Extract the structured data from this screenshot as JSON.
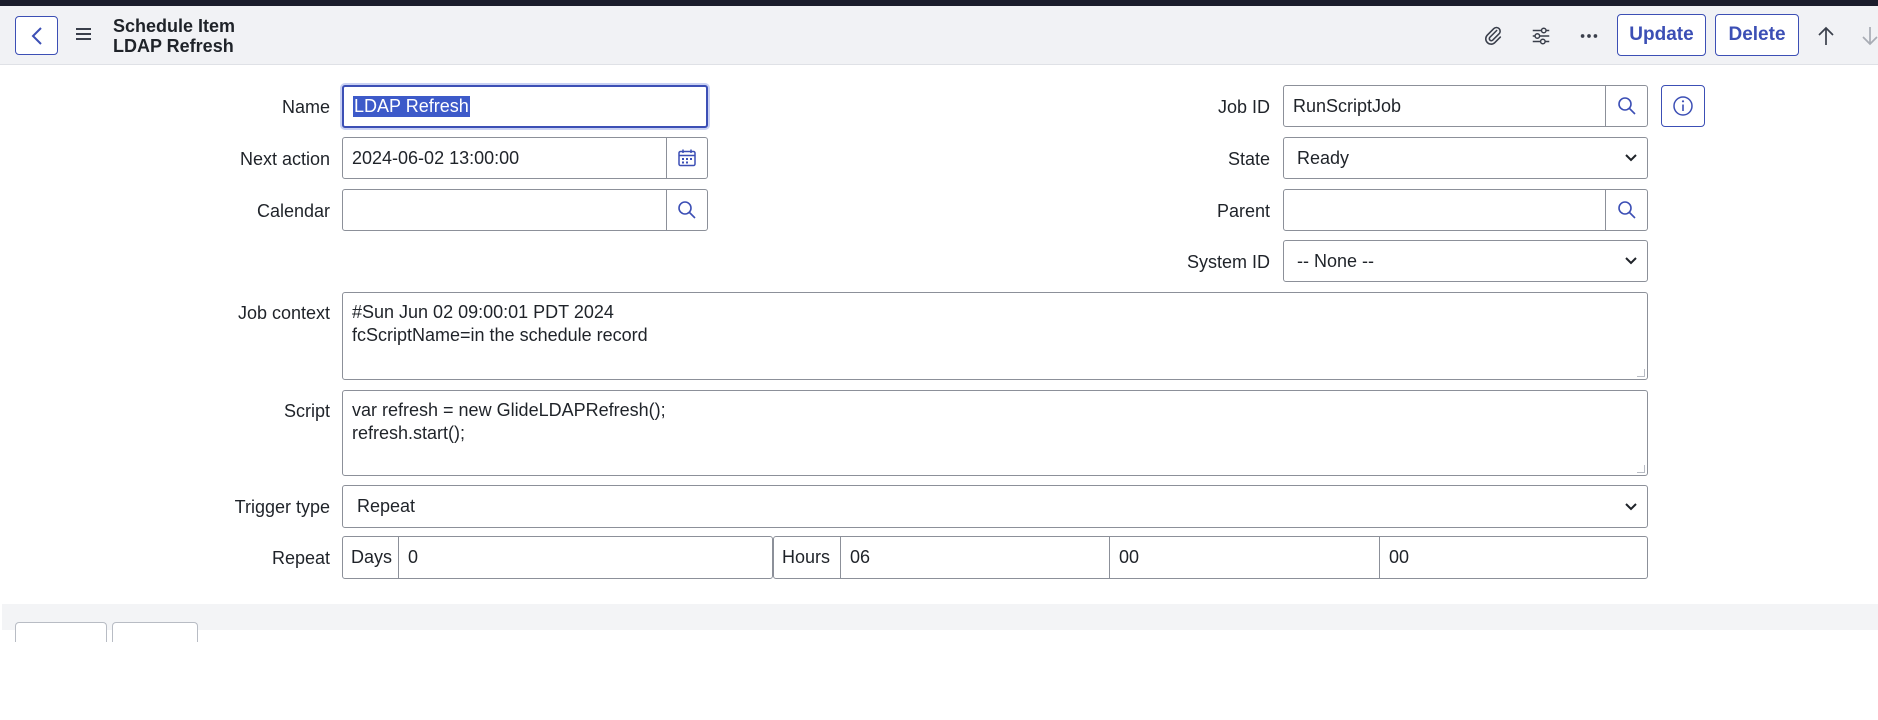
{
  "header": {
    "title_line1": "Schedule Item",
    "title_line2": "LDAP Refresh",
    "update_label": "Update",
    "delete_label": "Delete"
  },
  "form": {
    "name": {
      "label": "Name",
      "value": "LDAP Refresh"
    },
    "next_action": {
      "label": "Next action",
      "value": "2024-06-02 13:00:00"
    },
    "calendar": {
      "label": "Calendar",
      "value": ""
    },
    "job_id": {
      "label": "Job ID",
      "value": "RunScriptJob"
    },
    "state": {
      "label": "State",
      "value": "Ready"
    },
    "parent": {
      "label": "Parent",
      "value": ""
    },
    "system_id": {
      "label": "System ID",
      "value": "-- None --"
    },
    "job_context": {
      "label": "Job context",
      "lines": [
        "#Sun Jun 02 09:00:01 PDT 2024",
        "fcScriptName=in the schedule record"
      ]
    },
    "script": {
      "label": "Script",
      "lines": [
        "var refresh = new GlideLDAPRefresh();",
        "refresh.start();"
      ]
    },
    "trigger_type": {
      "label": "Trigger type",
      "value": "Repeat"
    },
    "repeat": {
      "label": "Repeat",
      "days_label": "Days",
      "days": "0",
      "hours_label": "Hours",
      "hours": "06",
      "minutes": "00",
      "seconds": "00"
    }
  },
  "colors": {
    "accent": "#3c4fb5",
    "header_bg": "#f1f2f5",
    "topbar": "#1b1d2c",
    "selection": "#3d5ac9"
  },
  "icons": [
    "chevron-left-icon",
    "hamburger-menu-icon",
    "paperclip-icon",
    "sliders-icon",
    "more-icon",
    "arrow-up-icon",
    "arrow-down-icon",
    "calendar-icon",
    "search-icon",
    "info-icon",
    "chevron-down-icon"
  ]
}
